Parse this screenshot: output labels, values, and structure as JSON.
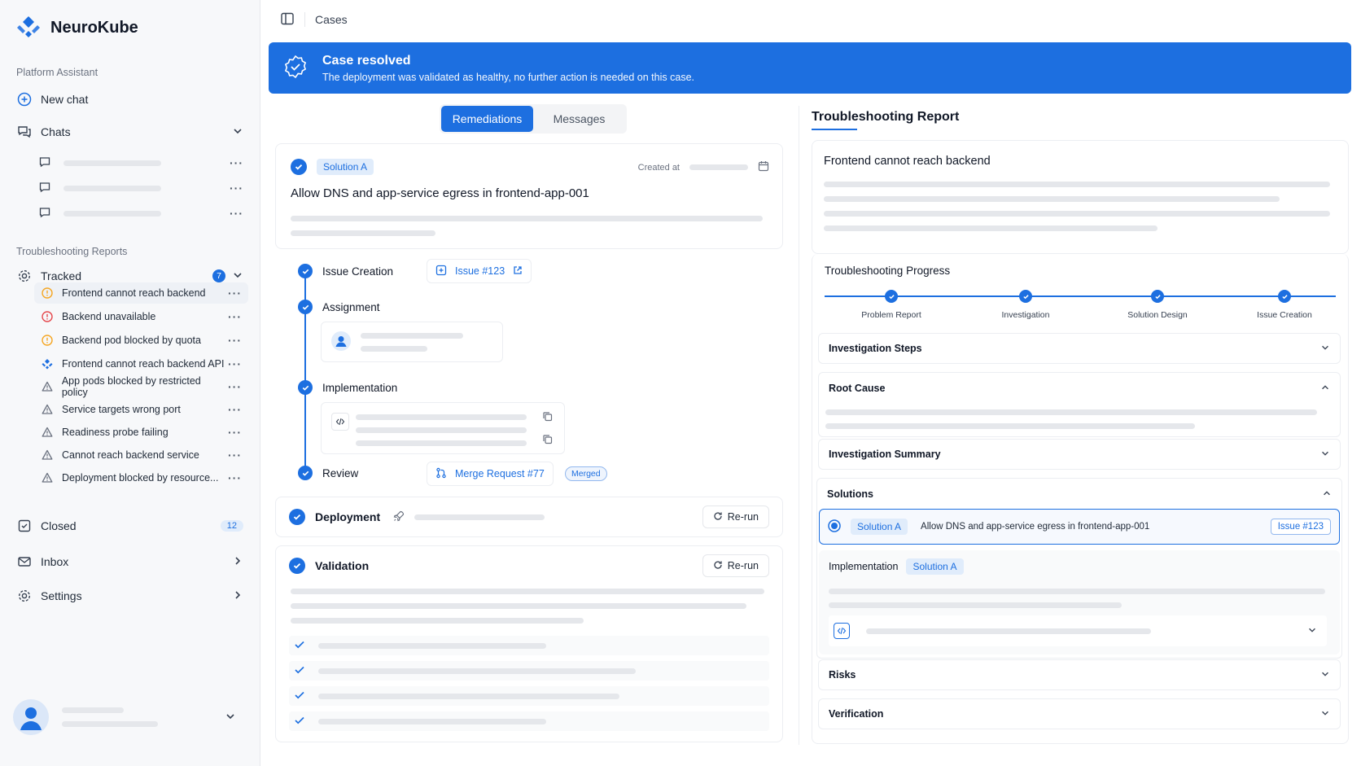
{
  "brand": {
    "name": "NeuroKube"
  },
  "sidebar": {
    "assistant_label": "Platform Assistant",
    "new_chat": "New chat",
    "chats": "Chats",
    "reports_label": "Troubleshooting Reports",
    "tracked": "Tracked",
    "tracked_count": "7",
    "reports": [
      {
        "label": "Frontend cannot reach backend",
        "icon": "warning-circle-icon",
        "color": "#f5a623"
      },
      {
        "label": "Backend unavailable",
        "icon": "error-circle-icon",
        "color": "#e5484d"
      },
      {
        "label": "Backend pod blocked by quota",
        "icon": "warning-circle-icon",
        "color": "#f5a623"
      },
      {
        "label": "Frontend cannot reach backend API",
        "icon": "brand-icon",
        "color": "#1d6fe0"
      },
      {
        "label": "App pods blocked by restricted policy",
        "icon": "triangle-alert-icon",
        "color": "#6b7280"
      },
      {
        "label": "Service targets wrong port",
        "icon": "triangle-alert-icon",
        "color": "#6b7280"
      },
      {
        "label": "Readiness probe failing",
        "icon": "triangle-alert-icon",
        "color": "#6b7280"
      },
      {
        "label": "Cannot reach backend service",
        "icon": "triangle-alert-icon",
        "color": "#6b7280"
      },
      {
        "label": "Deployment blocked by resource...",
        "icon": "triangle-alert-icon",
        "color": "#6b7280"
      }
    ],
    "closed": "Closed",
    "closed_count": "12",
    "inbox": "Inbox",
    "settings": "Settings"
  },
  "header": {
    "breadcrumb": "Cases"
  },
  "banner": {
    "title": "Case resolved",
    "message": "The deployment was validated as healthy, no further action is needed on this case."
  },
  "tabs": {
    "remediations": "Remediations",
    "messages": "Messages"
  },
  "solution": {
    "pill": "Solution A",
    "created_at_label": "Created at",
    "title": "Allow DNS and app-service egress in frontend-app-001"
  },
  "steps": {
    "issue_creation": "Issue Creation",
    "issue_link": "Issue #123",
    "assignment": "Assignment",
    "implementation": "Implementation",
    "review": "Review",
    "merge_request": "Merge Request #77",
    "merged": "Merged",
    "deployment": "Deployment",
    "validation": "Validation",
    "rerun": "Re-run"
  },
  "report": {
    "title": "Troubleshooting Report",
    "case_title": "Frontend cannot reach backend",
    "progress_title": "Troubleshooting Progress",
    "progress": [
      "Problem Report",
      "Investigation",
      "Solution Design",
      "Issue Creation"
    ],
    "investigation_steps": "Investigation Steps",
    "root_cause": "Root Cause",
    "investigation_summary": "Investigation Summary",
    "solutions": "Solutions",
    "solution_pill": "Solution A",
    "solution_text": "Allow DNS and app-service egress in frontend-app-001",
    "solution_issue": "Issue #123",
    "implementation": "Implementation",
    "implementation_pill": "Solution A",
    "risks": "Risks",
    "verification": "Verification"
  },
  "colors": {
    "accent": "#1d6fe0",
    "warning": "#f5a623",
    "error": "#e5484d"
  }
}
